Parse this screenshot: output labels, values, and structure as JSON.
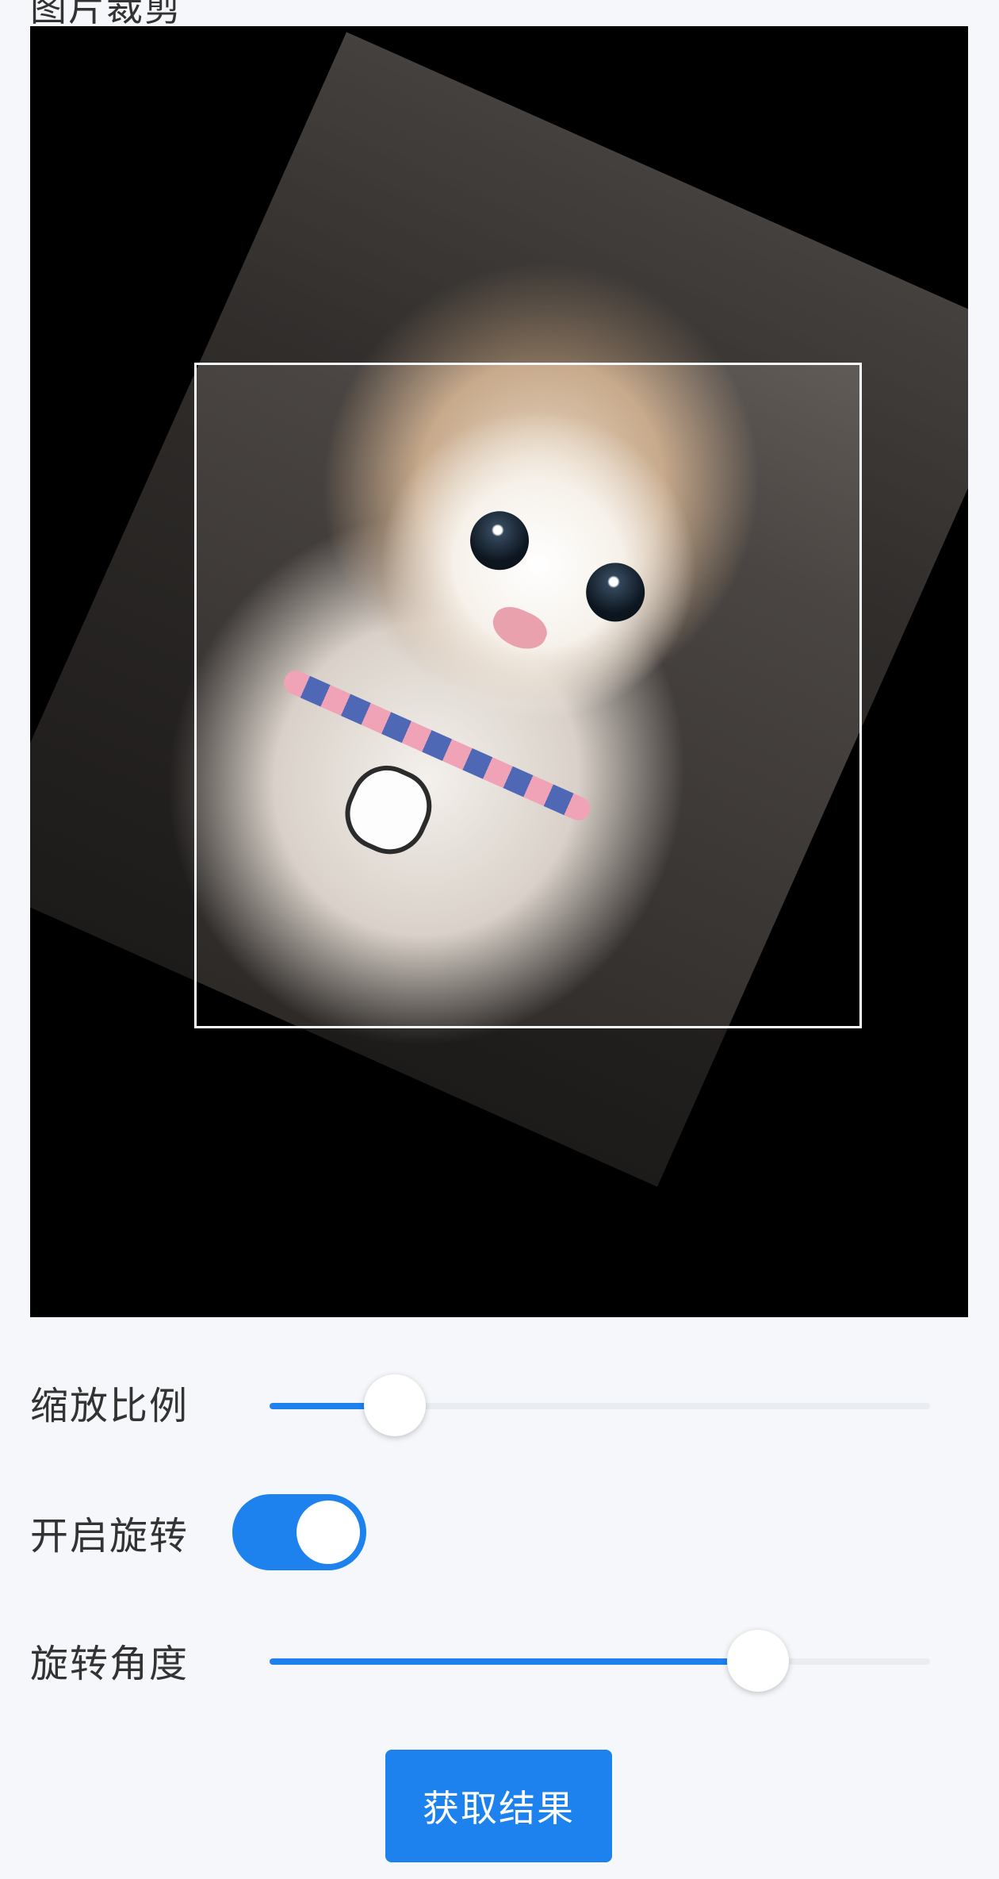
{
  "section_label": "图片裁剪",
  "controls": {
    "scale": {
      "label": "缩放比例",
      "value_fraction": 0.19
    },
    "rotate_toggle": {
      "label": "开启旋转",
      "on": true
    },
    "rotation": {
      "label": "旋转角度",
      "value_fraction": 0.74
    }
  },
  "action_button": {
    "label": "获取结果"
  },
  "colors": {
    "accent": "#1e82ee",
    "background": "#f5f7fa",
    "stage": "#000000"
  },
  "image": {
    "subject": "kitten photo",
    "icon": "kitten-photo"
  }
}
